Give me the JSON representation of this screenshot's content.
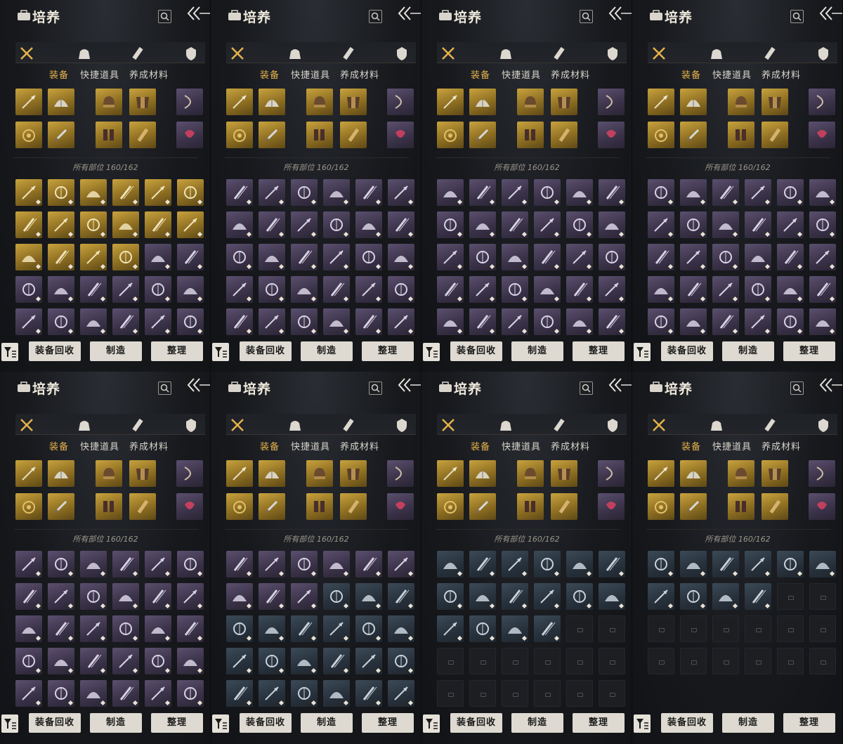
{
  "header": {
    "title": "培养"
  },
  "tabs": [
    {
      "label": "装备",
      "active": true
    },
    {
      "label": "快捷道具",
      "active": false
    },
    {
      "label": "养成材料",
      "active": false
    }
  ],
  "category_icons": [
    "crossed-swords-icon",
    "pouch-icon",
    "scroll-icon",
    "rank-badge-icon"
  ],
  "capacity": "所有部位 160/162",
  "buttons": {
    "recycle": "装备回收",
    "craft": "制造",
    "sort": "整理"
  },
  "colors": {
    "accent": "#e6b24a",
    "gold": "#c8a23e",
    "purple": "#5b4f6e",
    "blue": "#3b4a58"
  },
  "equipped": {
    "rows": [
      [
        "gold",
        "gold",
        "gold",
        "gold",
        "purple"
      ],
      [
        "gold",
        "gold",
        "gold",
        "gold",
        "purple"
      ]
    ],
    "icons": [
      [
        "spear-icon",
        "fan-icon",
        "helmet-icon",
        "armor-icon",
        "bow-icon"
      ],
      [
        "pendant-icon",
        "dagger-icon",
        "gauntlet-icon",
        "scroll-case-icon",
        "knot-icon"
      ]
    ]
  },
  "panels": [
    {
      "rows": [
        [
          "gold",
          "gold",
          "gold",
          "gold",
          "gold",
          "gold"
        ],
        [
          "gold",
          "gold",
          "gold",
          "gold",
          "gold",
          "gold"
        ],
        [
          "gold",
          "gold",
          "gold",
          "gold",
          "purple",
          "purple"
        ],
        [
          "purple",
          "purple",
          "purple",
          "purple",
          "purple",
          "purple"
        ],
        [
          "purple",
          "purple",
          "purple",
          "purple",
          "purple",
          "purple"
        ]
      ]
    },
    {
      "rows": [
        [
          "purple",
          "purple",
          "purple",
          "purple",
          "purple",
          "purple"
        ],
        [
          "purple",
          "purple",
          "purple",
          "purple",
          "purple",
          "purple"
        ],
        [
          "purple",
          "purple",
          "purple",
          "purple",
          "purple",
          "purple"
        ],
        [
          "purple",
          "purple",
          "purple",
          "purple",
          "purple",
          "purple"
        ],
        [
          "purple",
          "purple",
          "purple",
          "purple",
          "purple",
          "purple"
        ]
      ]
    },
    {
      "rows": [
        [
          "purple",
          "purple",
          "purple",
          "purple",
          "purple",
          "purple"
        ],
        [
          "purple",
          "purple",
          "purple",
          "purple",
          "purple",
          "purple"
        ],
        [
          "purple",
          "purple",
          "purple",
          "purple",
          "purple",
          "purple"
        ],
        [
          "purple",
          "purple",
          "purple",
          "purple",
          "purple",
          "purple"
        ],
        [
          "purple",
          "purple",
          "purple",
          "purple",
          "purple",
          "purple"
        ]
      ]
    },
    {
      "rows": [
        [
          "purple",
          "purple",
          "purple",
          "purple",
          "purple",
          "purple"
        ],
        [
          "purple",
          "purple",
          "purple",
          "purple",
          "purple",
          "purple"
        ],
        [
          "purple",
          "purple",
          "purple",
          "purple",
          "purple",
          "purple"
        ],
        [
          "purple",
          "purple",
          "purple",
          "purple",
          "purple",
          "purple"
        ],
        [
          "purple",
          "purple",
          "purple",
          "purple",
          "purple",
          "purple"
        ]
      ]
    },
    {
      "rows": [
        [
          "purple",
          "purple",
          "purple",
          "purple",
          "purple",
          "purple"
        ],
        [
          "purple",
          "purple",
          "purple",
          "purple",
          "purple",
          "purple"
        ],
        [
          "purple",
          "purple",
          "purple",
          "purple",
          "purple",
          "purple"
        ],
        [
          "purple",
          "purple",
          "purple",
          "purple",
          "purple",
          "purple"
        ],
        [
          "purple",
          "purple",
          "purple",
          "purple",
          "purple",
          "purple"
        ]
      ]
    },
    {
      "rows": [
        [
          "purple",
          "purple",
          "purple",
          "purple",
          "purple",
          "purple"
        ],
        [
          "purple",
          "purple",
          "purple",
          "blue",
          "blue",
          "blue"
        ],
        [
          "blue",
          "blue",
          "blue",
          "blue",
          "blue",
          "blue"
        ],
        [
          "blue",
          "blue",
          "blue",
          "blue",
          "blue",
          "blue"
        ],
        [
          "blue",
          "blue",
          "blue",
          "blue",
          "blue",
          "blue"
        ]
      ]
    },
    {
      "rows": [
        [
          "blue",
          "blue",
          "blue",
          "blue",
          "blue",
          "blue"
        ],
        [
          "blue",
          "blue",
          "blue",
          "blue",
          "blue",
          "blue"
        ],
        [
          "blue",
          "blue",
          "blue",
          "blue",
          "empty",
          "empty"
        ],
        [
          "empty",
          "empty",
          "empty",
          "empty",
          "empty",
          "empty"
        ],
        [
          "empty",
          "empty",
          "empty",
          "empty",
          "empty",
          "empty"
        ]
      ]
    },
    {
      "rows": [
        [
          "blue",
          "blue",
          "blue",
          "blue",
          "blue",
          "blue"
        ],
        [
          "blue",
          "blue",
          "blue",
          "blue",
          "empty",
          "empty"
        ],
        [
          "empty",
          "empty",
          "empty",
          "empty",
          "empty",
          "empty"
        ],
        [
          "empty",
          "empty",
          "empty",
          "empty",
          "empty",
          "empty"
        ]
      ]
    }
  ]
}
